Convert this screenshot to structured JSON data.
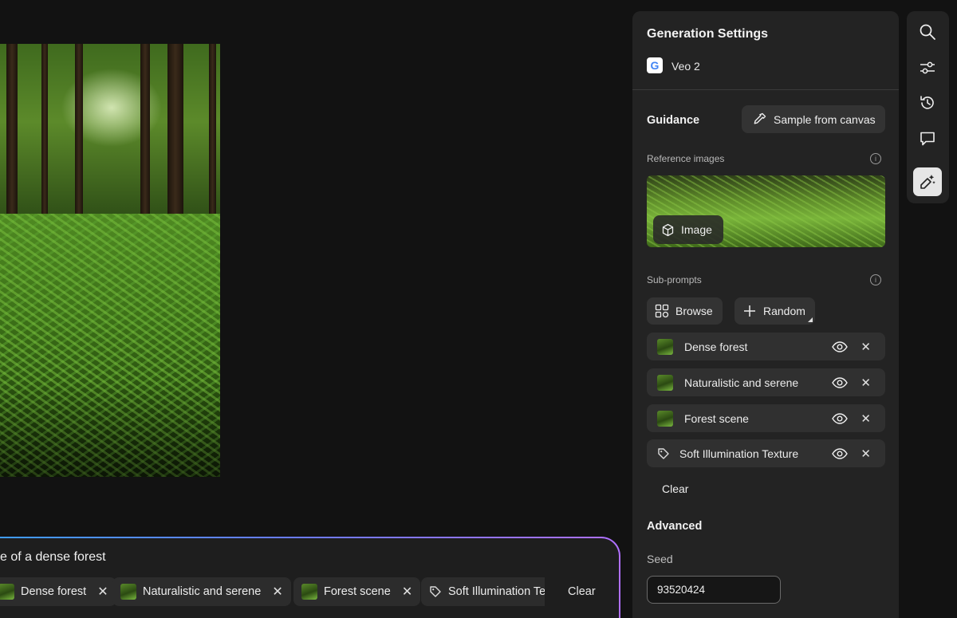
{
  "canvas": {
    "prompt_text": "e of a dense forest",
    "chips": [
      {
        "label": "Dense forest",
        "kind": "image"
      },
      {
        "label": "Naturalistic and serene",
        "kind": "image"
      },
      {
        "label": "Forest scene",
        "kind": "image"
      },
      {
        "label": "Soft Illumination Te",
        "kind": "tag"
      }
    ],
    "clear_label": "Clear"
  },
  "panel": {
    "title": "Generation Settings",
    "model_logo_letter": "G",
    "model_name": "Veo 2",
    "guidance_heading": "Guidance",
    "sample_button": "Sample from canvas",
    "reference_label": "Reference images",
    "reference_tag": "Image",
    "subprompts_label": "Sub-prompts",
    "browse_button": "Browse",
    "random_button": "Random",
    "subprompts": [
      {
        "label": "Dense forest",
        "kind": "image"
      },
      {
        "label": "Naturalistic and serene",
        "kind": "image"
      },
      {
        "label": "Forest scene",
        "kind": "image"
      },
      {
        "label": "Soft Illumination Texture",
        "kind": "tag"
      }
    ],
    "clear_label": "Clear",
    "advanced_heading": "Advanced",
    "seed_label": "Seed",
    "seed_value": "93520424"
  },
  "toolbar": {
    "icons": [
      "search-icon",
      "sliders-icon",
      "history-icon",
      "comment-icon",
      "generate-icon"
    ],
    "active": "generate-icon"
  },
  "colors": {
    "background": "#121212",
    "panel": "#232323",
    "prompt_gradient": [
      "#3aa0ff",
      "#6a7bff",
      "#b070ff"
    ]
  }
}
